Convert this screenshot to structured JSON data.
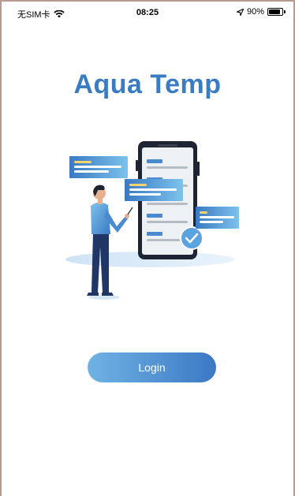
{
  "status_bar": {
    "carrier": "无SIM卡",
    "time": "08:25",
    "battery_percent": "90%",
    "battery_level": 0.9
  },
  "app": {
    "title": "Aqua Temp"
  },
  "login": {
    "label": "Login"
  },
  "colors": {
    "brand": "#3a7cc4",
    "button_start": "#6fb3e4",
    "button_end": "#3c78c4"
  }
}
